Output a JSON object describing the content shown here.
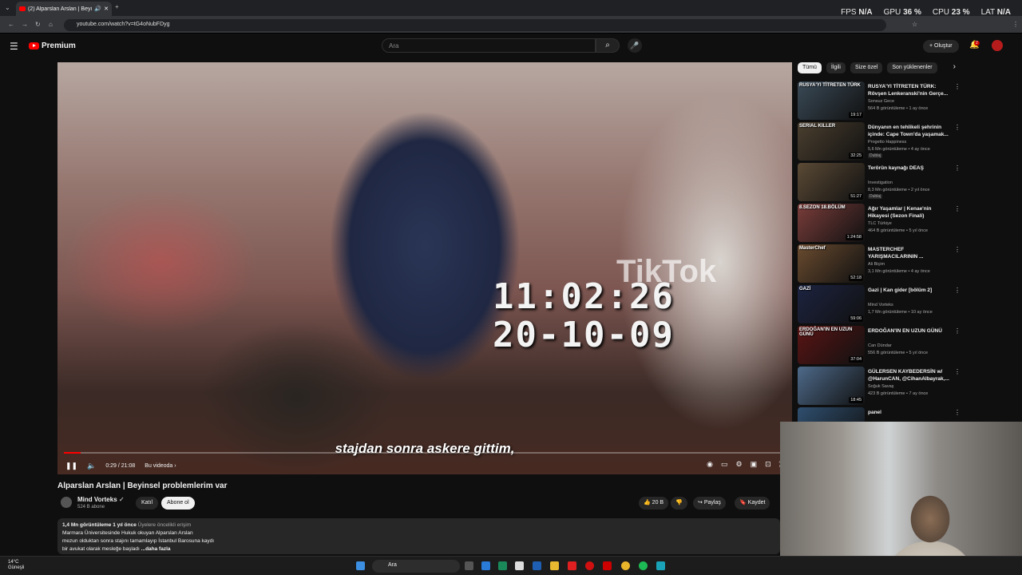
{
  "browser": {
    "tab_title": "(2) Alparslan Arslan | Beyin...",
    "url": "youtube.com/watch?v=tG4oNubFDyg"
  },
  "overlay": {
    "fps_label": "FPS",
    "fps_value": "N/A",
    "gpu_label": "GPU",
    "gpu_value": "36 %",
    "cpu_label": "CPU",
    "cpu_value": "23 %",
    "lat_label": "LAT",
    "lat_value": "N/A"
  },
  "header": {
    "logo_text": "Premium",
    "search_placeholder": "Ara",
    "create_label": "Oluştur",
    "notification_count": "2"
  },
  "player": {
    "video_timestamp": "11:02:26\n20-10-09",
    "watermark": "TikTok",
    "subtitle": "stajdan sonra askere gittim,",
    "time_display": "0:29 / 21:08",
    "in_video_label": "Bu videoda",
    "progress_fraction": 0.023
  },
  "video": {
    "title": "Alparslan Arslan | Beyinsel problemlerim var",
    "channel_name": "Mind Vorteks",
    "subscribers": "524 B abone",
    "join_label": "Katıl",
    "subscribe_label": "Abone ol",
    "likes": "20 B",
    "share_label": "Paylaş",
    "save_label": "Kaydet",
    "views_stats": "1,4 Mn görüntüleme  1 yıl önce",
    "priority_tag": "Üyelere öncelikli erişim",
    "desc_line1": "Marmara Üniversitesinde Hukuk okuyan Alparslan Arslan",
    "desc_line2": "mezun olduktan sonra stajını tamamlayıp İstanbul Barosuna kaydı",
    "desc_line3": "bir avukat olarak mesleğe başladı",
    "desc_more": "...daha fazla"
  },
  "chips": [
    "Tümü",
    "İlgili",
    "Size özel",
    "Son yüklenenler"
  ],
  "recommendations": [
    {
      "thumb_text": "RUSYA'YI TİTRETEN TÜRK",
      "title": "RUSYA'YI TİTRETEN TÜRK: Rövşen Lenkeranski'nin Gerçe...",
      "channel": "Sonsuz Gece",
      "stats": "564 B görüntüleme • 1 ay önce",
      "duration": "19:17",
      "dub": "",
      "color": "#3a4a57"
    },
    {
      "thumb_text": "SERIAL KILLER",
      "title": "Dünyanın en tehlikeli şehrinin içinde: Cape Town'da yaşamak...",
      "channel": "Progetto Happiness",
      "stats": "5,6 Mn görüntüleme • 4 ay önce",
      "duration": "32:25",
      "dub": "Dublaj",
      "color": "#4b3f2f"
    },
    {
      "thumb_text": "",
      "title": "Terörün kaynağı DEAŞ",
      "channel": "Investigation",
      "stats": "8,3 Mn görüntüleme • 2 yıl önce",
      "duration": "51:27",
      "dub": "Dublaj",
      "color": "#5b4a35"
    },
    {
      "thumb_text": "8.SEZON 18.BÖLÜM",
      "title": "Ağır Yaşamlar | Kenae'nin Hikayesi (Sezon Finali)",
      "channel": "TLC Türkiye",
      "stats": "464 B görüntüleme • 5 yıl önce",
      "duration": "1:24:58",
      "dub": "",
      "color": "#7a3d3a"
    },
    {
      "thumb_text": "MasterChef",
      "title": "MASTERCHEF YARIŞMACILARININ ...",
      "channel": "Ali Biçim",
      "stats": "3,1 Mn görüntüleme • 4 ay önce",
      "duration": "52:18",
      "dub": "",
      "color": "#6a4b2f"
    },
    {
      "thumb_text": "GAZİ",
      "title": "Gazi | Kan gider [bölüm 2]",
      "channel": "Mind Vorteks",
      "stats": "1,7 Mn görüntüleme • 10 ay önce",
      "duration": "59:06",
      "dub": "",
      "color": "#1c2340"
    },
    {
      "thumb_text": "ERDOĞAN'IN EN UZUN GÜNÜ",
      "title": "ERDOĞAN'IN EN UZUN GÜNÜ",
      "channel": "Can Dündar",
      "stats": "556 B görüntüleme • 5 yıl önce",
      "duration": "37:04",
      "dub": "",
      "color": "#5a1414"
    },
    {
      "thumb_text": "",
      "title": "GÜLERSEN KAYBEDERSİN w/ @HarunCAN, @CihanAlbayrak,...",
      "channel": "Soğuk Savaş",
      "stats": "423 B görüntüleme • 7 ay önce",
      "duration": "18:45",
      "dub": "",
      "color": "#4e6a8a"
    },
    {
      "thumb_text": "",
      "title": "panel",
      "channel": "",
      "stats": "",
      "duration": "",
      "dub": "",
      "color": "#2f4f6f"
    }
  ],
  "taskbar": {
    "temperature": "14°C",
    "weather": "Güneşli",
    "search_label": "Ara"
  }
}
